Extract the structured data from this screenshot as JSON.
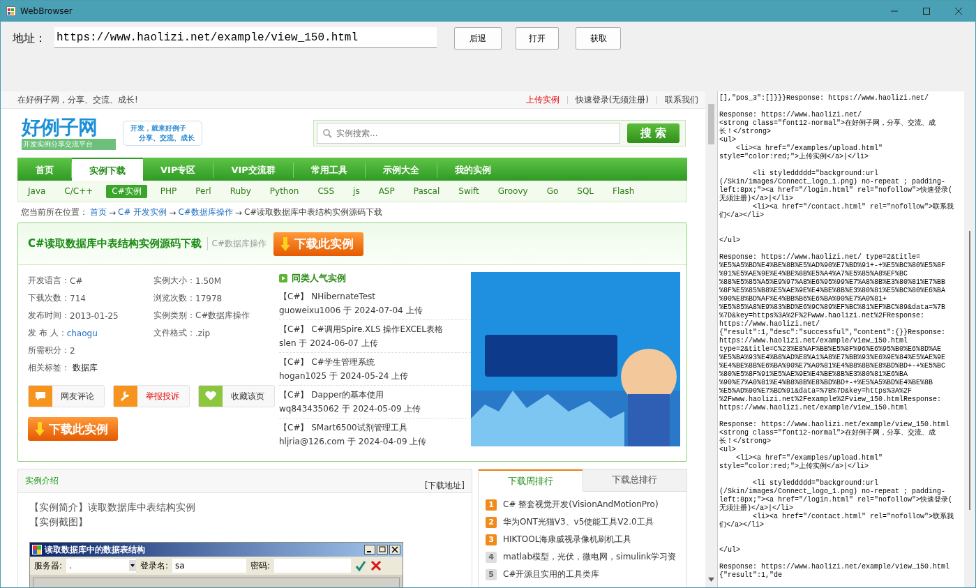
{
  "window": {
    "title": "WebBrowser"
  },
  "toolbar": {
    "address_label": "地址：",
    "address": "https://www.haolizi.net/example/view_150.html",
    "buttons": [
      "后退",
      "打开",
      "获取"
    ]
  },
  "page": {
    "topbar": {
      "slogan": "在好例子网，分享、交流、成长!",
      "links": [
        {
          "text": "上传实例",
          "kind": "hot"
        },
        {
          "text": "快速登录(无须注册)",
          "kind": "plain"
        },
        {
          "text": "联系我们",
          "kind": "plain"
        }
      ]
    },
    "header": {
      "logo_title": "好例子网",
      "logo_subtitle": "开发实例分享交流平台",
      "bubble_lines": [
        "开发，就来**好例子**",
        "分享、交流、成长"
      ],
      "search_placeholder": "实例搜索...",
      "search_button": "搜 索"
    },
    "nav": [
      {
        "label": "首页",
        "selected": false
      },
      {
        "label": "实例下载",
        "selected": true
      },
      {
        "label": "VIP专区",
        "selected": false
      },
      {
        "label": "VIP交流群",
        "selected": false
      },
      {
        "label": "常用工具",
        "selected": false
      },
      {
        "label": "示例大全",
        "selected": false
      },
      {
        "label": "我的实例",
        "selected": false
      }
    ],
    "languages": [
      {
        "label": "Java",
        "selected": false
      },
      {
        "label": "C/C++",
        "selected": false
      },
      {
        "label": "C#实例",
        "selected": true
      },
      {
        "label": "PHP",
        "selected": false
      },
      {
        "label": "Perl",
        "selected": false
      },
      {
        "label": "Ruby",
        "selected": false
      },
      {
        "label": "Python",
        "selected": false
      },
      {
        "label": "CSS",
        "selected": false
      },
      {
        "label": "js",
        "selected": false
      },
      {
        "label": "ASP",
        "selected": false
      },
      {
        "label": "Pascal",
        "selected": false
      },
      {
        "label": "Swift",
        "selected": false
      },
      {
        "label": "Groovy",
        "selected": false
      },
      {
        "label": "Go",
        "selected": false
      },
      {
        "label": "SQL",
        "selected": false
      },
      {
        "label": "Flash",
        "selected": false
      }
    ],
    "breadcrumb": [
      {
        "text": "您当前所在位置：",
        "kind": "text"
      },
      {
        "text": "首页",
        "kind": "link"
      },
      {
        "text": "→",
        "kind": "sep"
      },
      {
        "text": "C# 开发实例",
        "kind": "link"
      },
      {
        "text": "→",
        "kind": "sep"
      },
      {
        "text": "C#数据库操作",
        "kind": "link"
      },
      {
        "text": "→",
        "kind": "sep"
      },
      {
        "text": "C#读取数据库中表结构实例源码下载",
        "kind": "text"
      }
    ],
    "detail": {
      "title": "C#读取数据库中表结构实例源码下载",
      "category": "C#数据库操作",
      "download_button": "下载此实例",
      "info_left": [
        {
          "label": "开发语言：",
          "value": "C#",
          "kind": "plain"
        },
        {
          "label": "下载次数：",
          "value": "714",
          "kind": "plain"
        },
        {
          "label": "发布时间：",
          "value": "2013-01-25",
          "kind": "plain"
        },
        {
          "label": "发 布 人：",
          "value": "chaogu",
          "kind": "link"
        },
        {
          "label": "所需积分：",
          "value": "2",
          "kind": "plain"
        },
        {
          "label": "相关标签：",
          "value": "数据库",
          "kind": "tag"
        }
      ],
      "info_right": [
        {
          "label": "实例大小：",
          "value": "1.50M",
          "kind": "plain"
        },
        {
          "label": "浏览次数：",
          "value": "17978",
          "kind": "plain"
        },
        {
          "label": "实例类别：",
          "value": "C#数据库操作",
          "kind": "plain"
        },
        {
          "label": "文件格式：",
          "value": ".zip",
          "kind": "plain"
        }
      ],
      "actions": [
        {
          "label": "网友评论",
          "kind": "comment"
        },
        {
          "label": "举报投诉",
          "kind": "report"
        },
        {
          "label": "收藏该页",
          "kind": "favorite"
        }
      ],
      "download_button_bottom": "下载此实例",
      "related_title": "同类人气实例",
      "related": [
        {
          "title": "【C#】 NHibernateTest",
          "meta": "guoweixu1006 于 2024-07-04 上传"
        },
        {
          "title": "【C#】 C#调用Spire.XLS 操作EXCEL表格",
          "meta": "slen 于 2024-06-07 上传"
        },
        {
          "title": "【C#】 C#学生管理系统",
          "meta": "hogan1025 于 2024-05-24 上传"
        },
        {
          "title": "【C#】 Dapper的基本使用",
          "meta": "wq843435062 于 2024-05-09 上传"
        },
        {
          "title": "【C#】 SMart6500试剂管理工具",
          "meta": "hljria@126.com 于 2024-04-09 上传"
        }
      ]
    },
    "intro": {
      "tab": "实例介绍",
      "download_link": "[下载地址]",
      "paragraphs": [
        "【实例简介】读取数据库中表结构实例",
        "【实例截图】"
      ],
      "screenshot": {
        "title": "读取数据库中的数据表结构",
        "server_label": "服务器:",
        "server_value": ".",
        "login_label": "登录名:",
        "login_value": "sa",
        "password_label": "密码:"
      }
    },
    "ranking": {
      "tabs": [
        {
          "label": "下载周排行",
          "selected": true
        },
        {
          "label": "下载总排行",
          "selected": false
        }
      ],
      "items": [
        {
          "rank": "1",
          "title": "C# 整套视觉开发(VisionAndMotionPro)",
          "hot": true
        },
        {
          "rank": "2",
          "title": "华为ONT光猫V3、v5使能工具V2.0工具",
          "hot": true
        },
        {
          "rank": "3",
          "title": "HIKTOOL海康威视录像机刷机工具",
          "hot": true
        },
        {
          "rank": "4",
          "title": "matlab模型，光伏，微电网，simulink学习资",
          "hot": false
        },
        {
          "rank": "5",
          "title": "C#开源且实用的工具类库",
          "hot": false
        }
      ]
    }
  },
  "log": {
    "blocks": [
      {
        "blank_before": false,
        "extra_blank": false,
        "lines": [
          "[],\"pos_3\":[]}}}Response: https://www.haolizi.net/"
        ]
      },
      {
        "blank_before": true,
        "extra_blank": false,
        "lines": [
          "Response: https://www.haolizi.net/",
          "<strong class=\"font12-normal\">在好例子网，分享、交流、成",
          "长！</strong>",
          "<ul>",
          "    <li><a href=\"/examples/upload.html\"",
          "style=\"color:red;\">上传实例</a>|</li>"
        ]
      },
      {
        "blank_before": true,
        "extra_blank": false,
        "lines": [
          "        <li styleddddd=\"background:url",
          "(/Skin/images/Connect_logo_1.png) no-repeat ; padding-",
          "left:8px;\"><a href=\"/login.html\" rel=\"nofollow\">快速登录(",
          "无须注册)</a>|</li>",
          "        <li><a href=\"/contact.html\" rel=\"nofollow\">联系我",
          "们</a></li>"
        ]
      },
      {
        "blank_before": true,
        "extra_blank": true,
        "lines": [
          "</ul>"
        ]
      },
      {
        "blank_before": true,
        "extra_blank": false,
        "lines": [
          "Response: https://www.haolizi.net/ type=2&title=",
          "%E5%A5%BD%E4%BE%8B%E5%AD%90%E7%BD%91+-+%E5%BC%80%E5%8F",
          "%91%E5%AE%9E%E4%BE%8B%E5%A4%A7%E5%85%A8%EF%BC",
          "%88%E5%85%A5%E9%97%A8%E6%95%99%E7%A8%8B%E3%80%81%E7%BB",
          "%8F%E5%85%B8%E5%AE%9E%E4%BE%8B%E3%80%81%E5%BC%80%E6%BA",
          "%90%E8%BD%AF%E4%BB%B6%E6%BA%90%E7%A0%81+",
          "%E5%85%A8%E9%83%BD%E6%9C%89%EF%BC%81%EF%BC%89&data=%7B",
          "%7D&key=https%3A%2F%2Fwww.haolizi.net%2FResponse:",
          "https://www.haolizi.net/",
          "{\"result\":1,\"desc\":\"successful\",\"content\":{}}Response:",
          "https://www.haolizi.net/example/view_150.html",
          "type=2&title=C%23%E8%AF%BB%E5%8F%96%E6%95%B0%E6%8D%AE",
          "%E5%BA%93%E4%B8%AD%E8%A1%A8%E7%BB%93%E6%9E%84%E5%AE%9E",
          "%E4%BE%8B%E6%BA%90%E7%A0%81%E4%B8%8B%E8%BD%BD+-+%E5%BC",
          "%80%E5%8F%91%E5%AE%9E%E4%BE%8B%E3%80%81%E6%BA",
          "%90%E7%A0%81%E4%B8%8B%E8%BD%BD+-+%E5%A5%BD%E4%BE%8B",
          "%E5%AD%90%E7%BD%91&data=%7B%7D&key=https%3A%2F",
          "%2Fwww.haolizi.net%2Fexample%2Fview_150.htmlResponse:",
          "https://www.haolizi.net/example/view_150.html"
        ]
      },
      {
        "blank_before": true,
        "extra_blank": false,
        "lines": [
          "Response: https://www.haolizi.net/example/view_150.html",
          "<strong class=\"font12-normal\">在好例子网，分享、交流、成",
          "长！</strong>",
          "<ul>",
          "    <li><a href=\"/examples/upload.html\"",
          "style=\"color:red;\">上传实例</a>|</li>"
        ]
      },
      {
        "blank_before": true,
        "extra_blank": false,
        "lines": [
          "        <li styleddddd=\"background:url",
          "(/Skin/images/Connect_logo_1.png) no-repeat ; padding-",
          "left:8px;\"><a href=\"/login.html\" rel=\"nofollow\">快速登录(",
          "无须注册)</a>|</li>",
          "        <li><a href=\"/contact.html\" rel=\"nofollow\">联系我",
          "们</a></li>"
        ]
      },
      {
        "blank_before": true,
        "extra_blank": true,
        "lines": [
          "</ul>"
        ]
      },
      {
        "blank_before": true,
        "extra_blank": false,
        "lines": [
          "Response: https://www.haolizi.net/example/view_150.html",
          "{\"result\":1,\"de"
        ]
      }
    ]
  }
}
